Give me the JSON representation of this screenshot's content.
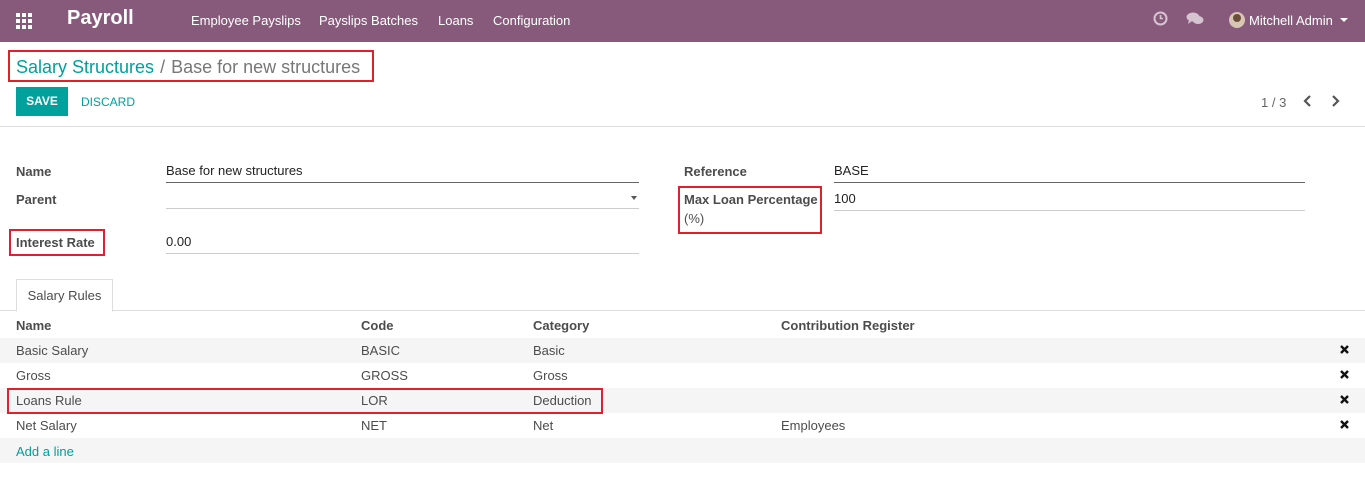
{
  "navbar": {
    "app_name": "Payroll",
    "menu": [
      "Employee Payslips",
      "Payslips Batches",
      "Loans",
      "Configuration"
    ],
    "user_name": "Mitchell Admin",
    "accent": "#875a7b"
  },
  "breadcrumb": {
    "parent": "Salary Structures",
    "separator": "/",
    "current": "Base for new structures"
  },
  "buttons": {
    "save": "SAVE",
    "discard": "DISCARD"
  },
  "pager": {
    "value": "1 / 3"
  },
  "form": {
    "name_label": "Name",
    "name_value": "Base for new structures",
    "parent_label": "Parent",
    "parent_value": "",
    "interest_label": "Interest Rate",
    "interest_value": "0.00",
    "reference_label": "Reference",
    "reference_value": "BASE",
    "max_loan_label_1": "Max Loan Percentage",
    "max_loan_label_2": "(%)",
    "max_loan_value": "100"
  },
  "tabs": [
    "Salary Rules"
  ],
  "table": {
    "headers": [
      "Name",
      "Code",
      "Category",
      "Contribution Register"
    ],
    "rows": [
      [
        "Basic Salary",
        "BASIC",
        "Basic",
        ""
      ],
      [
        "Gross",
        "GROSS",
        "Gross",
        ""
      ],
      [
        "Loans Rule",
        "LOR",
        "Deduction",
        ""
      ],
      [
        "Net Salary",
        "NET",
        "Net",
        "Employees"
      ]
    ],
    "add_line": "Add a line"
  },
  "highlight_color": "#e0202c",
  "link_color": "#00a09d"
}
